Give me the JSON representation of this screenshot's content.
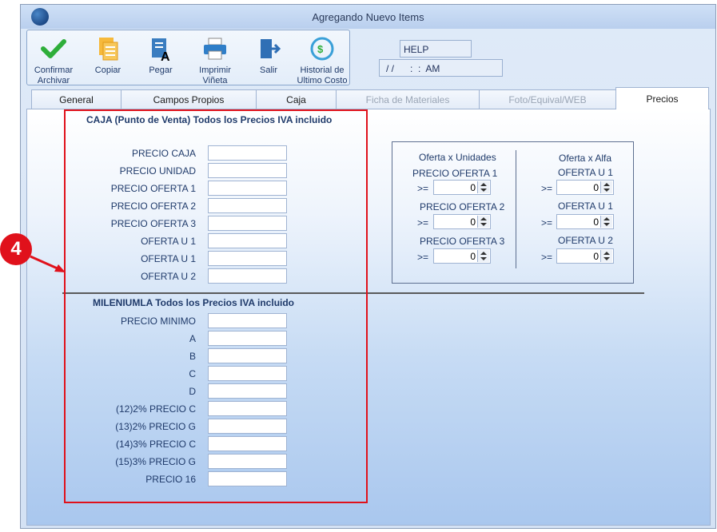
{
  "window": {
    "title": "Agregando Nuevo Items"
  },
  "toolbar": {
    "confirm": "Confirmar\nArchivar",
    "copy": "Copiar",
    "paste": "Pegar",
    "print": "Imprimir\nViñeta",
    "exit": "Salir",
    "history": "Historial de\nUltimo Costo"
  },
  "help": "HELP",
  "datetime": "/ /      :  :  AM",
  "tabs": [
    "General",
    "Campos Propios",
    "Caja",
    "Ficha de Materiales",
    "Foto/Equival/WEB",
    "Precios"
  ],
  "caja": {
    "title": "CAJA (Punto de Venta) Todos los Precios IVA incluido",
    "labels": [
      "PRECIO CAJA",
      "PRECIO UNIDAD",
      "PRECIO OFERTA 1",
      "PRECIO OFERTA 2",
      "PRECIO OFERTA 3",
      "OFERTA U 1",
      "OFERTA U 1",
      "OFERTA U 2"
    ]
  },
  "mileniumla": {
    "title": "MILENIUMLA  Todos los Precios IVA incluido",
    "labels": [
      "PRECIO MINIMO",
      "A",
      "B",
      "C",
      "D",
      "(12)2% PRECIO C",
      "(13)2% PRECIO G",
      "(14)3% PRECIO C",
      "(15)3% PRECIO G",
      "PRECIO 16"
    ]
  },
  "ofertas": {
    "units_header": "Oferta x Unidades",
    "alfa_header": "Oferta x Alfa",
    "left": [
      {
        "label": "PRECIO OFERTA 1",
        "op": ">=",
        "value": "0"
      },
      {
        "label": "PRECIO OFERTA 2",
        "op": ">=",
        "value": "0"
      },
      {
        "label": "PRECIO OFERTA 3",
        "op": ">=",
        "value": "0"
      }
    ],
    "right": [
      {
        "label": "OFERTA U 1",
        "op": ">=",
        "value": "0"
      },
      {
        "label": "OFERTA U 1",
        "op": ">=",
        "value": "0"
      },
      {
        "label": "OFERTA U 2",
        "op": ">=",
        "value": "0"
      }
    ]
  },
  "annotation": {
    "number": "4"
  },
  "colors": {
    "highlight": "#e0111b",
    "accent": "#1f3a6a"
  }
}
